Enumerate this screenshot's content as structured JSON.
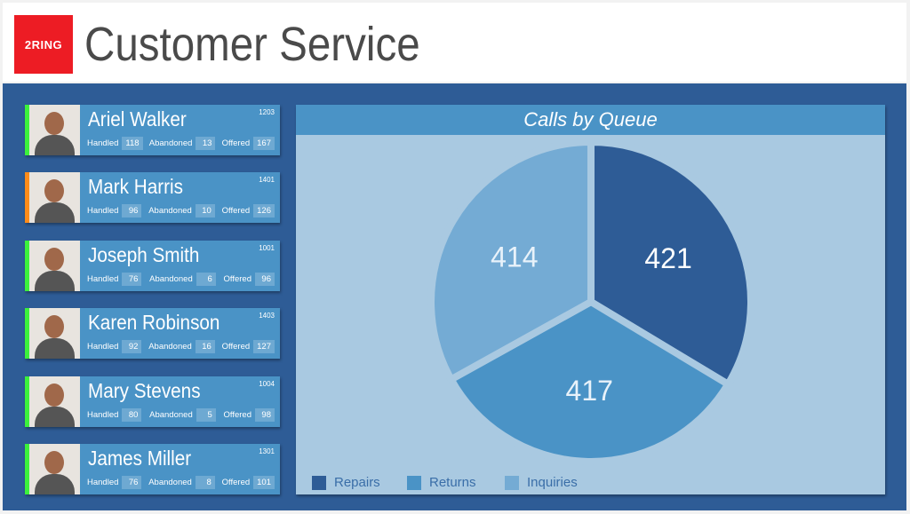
{
  "header": {
    "logo_text": "2RING",
    "title": "Customer Service"
  },
  "agents": [
    {
      "name": "Ariel Walker",
      "ext": "1203",
      "handled": "118",
      "abandoned": "13",
      "offered": "167",
      "status_color": "#3cf03c"
    },
    {
      "name": "Mark Harris",
      "ext": "1401",
      "handled": "96",
      "abandoned": "10",
      "offered": "126",
      "status_color": "#ff8c1a"
    },
    {
      "name": "Joseph Smith",
      "ext": "1001",
      "handled": "76",
      "abandoned": "6",
      "offered": "96",
      "status_color": "#3cf03c"
    },
    {
      "name": "Karen Robinson",
      "ext": "1403",
      "handled": "92",
      "abandoned": "16",
      "offered": "127",
      "status_color": "#3cf03c"
    },
    {
      "name": "Mary Stevens",
      "ext": "1004",
      "handled": "80",
      "abandoned": "5",
      "offered": "98",
      "status_color": "#3cf03c"
    },
    {
      "name": "James Miller",
      "ext": "1301",
      "handled": "76",
      "abandoned": "8",
      "offered": "101",
      "status_color": "#3cf03c"
    }
  ],
  "labels": {
    "handled": "Handled",
    "abandoned": "Abandoned",
    "offered": "Offered"
  },
  "chart_data": {
    "type": "pie",
    "title": "Calls by Queue",
    "categories": [
      "Repairs",
      "Returns",
      "Inquiries"
    ],
    "values": [
      421,
      417,
      414
    ],
    "colors": [
      "#2e5c96",
      "#4a93c6",
      "#74abd4"
    ],
    "legend": "bottom"
  }
}
